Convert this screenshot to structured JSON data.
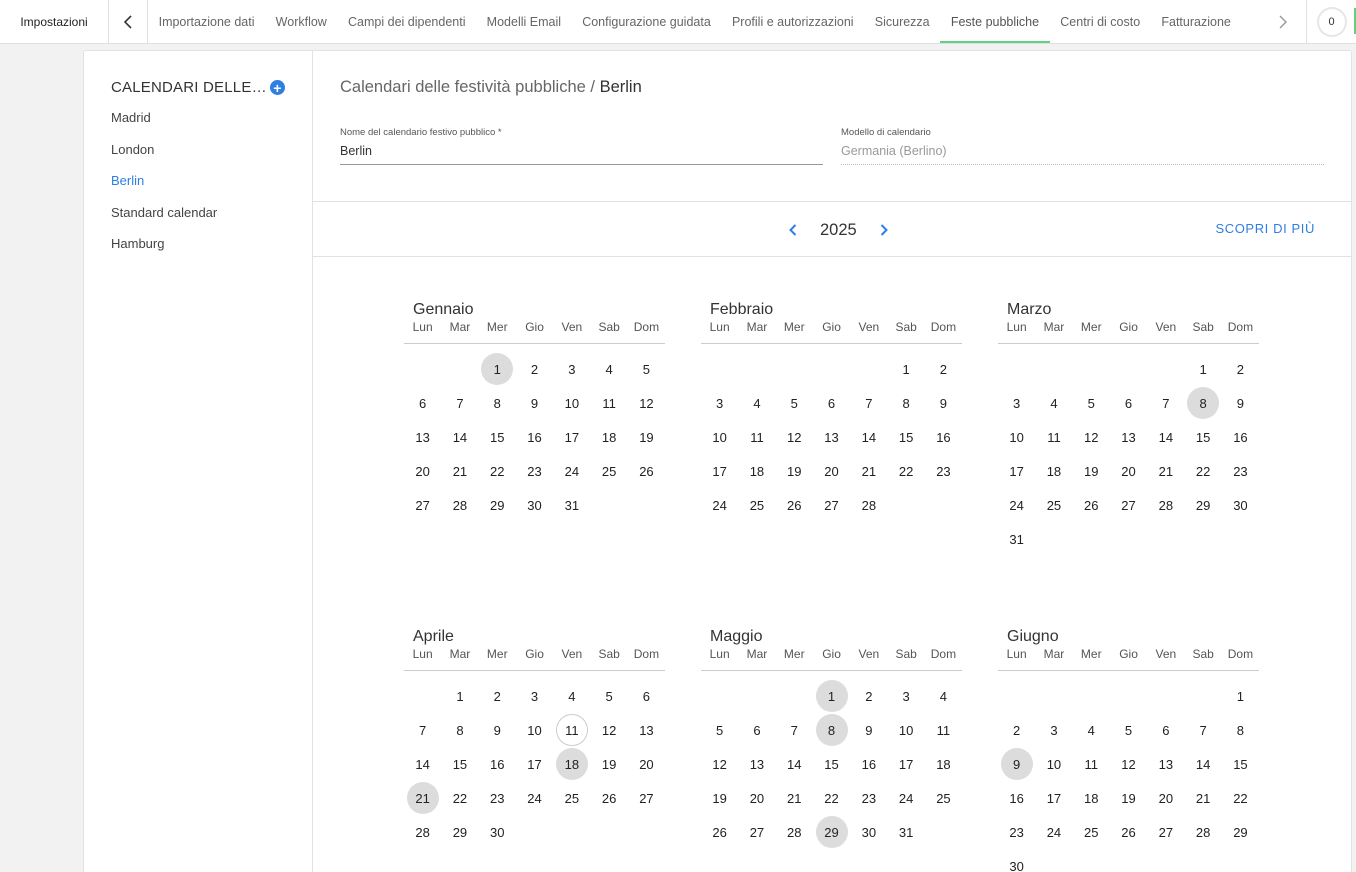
{
  "topbar": {
    "settings_label": "Impostazioni",
    "tabs": [
      "Importazione dati",
      "Workflow",
      "Campi dei dipendenti",
      "Modelli Email",
      "Configurazione guidata",
      "Profili e autorizzazioni",
      "Sicurezza",
      "Feste pubbliche",
      "Centri di costo",
      "Fatturazione"
    ],
    "active_tab": "Feste pubbliche",
    "counter": "0",
    "accent_color": "#5fd17f"
  },
  "sidebar": {
    "title": "CALENDARI DELLE FESTIVITÀ PUBBLICHE",
    "items": [
      "Madrid",
      "London",
      "Berlin",
      "Standard calendar",
      "Hamburg"
    ],
    "active_item": "Berlin"
  },
  "main": {
    "breadcrumb_parent": "Calendari delle festività pubbliche /",
    "breadcrumb_current": "Berlin",
    "name_field": {
      "label": "Nome del calendario festivo pubblico *",
      "value": "Berlin"
    },
    "template_field": {
      "label": "Modello di calendario",
      "value": "Germania (Berlino)"
    },
    "year": "2025",
    "learn_more": "SCOPRI DI PIÙ",
    "link_color": "#2f7fe0"
  },
  "calendar": {
    "weekdays": [
      "Lun",
      "Mar",
      "Mer",
      "Gio",
      "Ven",
      "Sab",
      "Dom"
    ],
    "months": [
      {
        "name": "Gennaio",
        "offset": 2,
        "days": 31,
        "holidays": [
          1
        ]
      },
      {
        "name": "Febbraio",
        "offset": 5,
        "days": 28,
        "holidays": []
      },
      {
        "name": "Marzo",
        "offset": 5,
        "days": 31,
        "holidays": [
          8
        ]
      },
      {
        "name": "Aprile",
        "offset": 1,
        "days": 30,
        "holidays": [
          18,
          21
        ],
        "today": 11
      },
      {
        "name": "Maggio",
        "offset": 3,
        "days": 31,
        "holidays": [
          1,
          8,
          29
        ]
      },
      {
        "name": "Giugno",
        "offset": 6,
        "days": 30,
        "holidays": [
          9
        ]
      }
    ]
  }
}
